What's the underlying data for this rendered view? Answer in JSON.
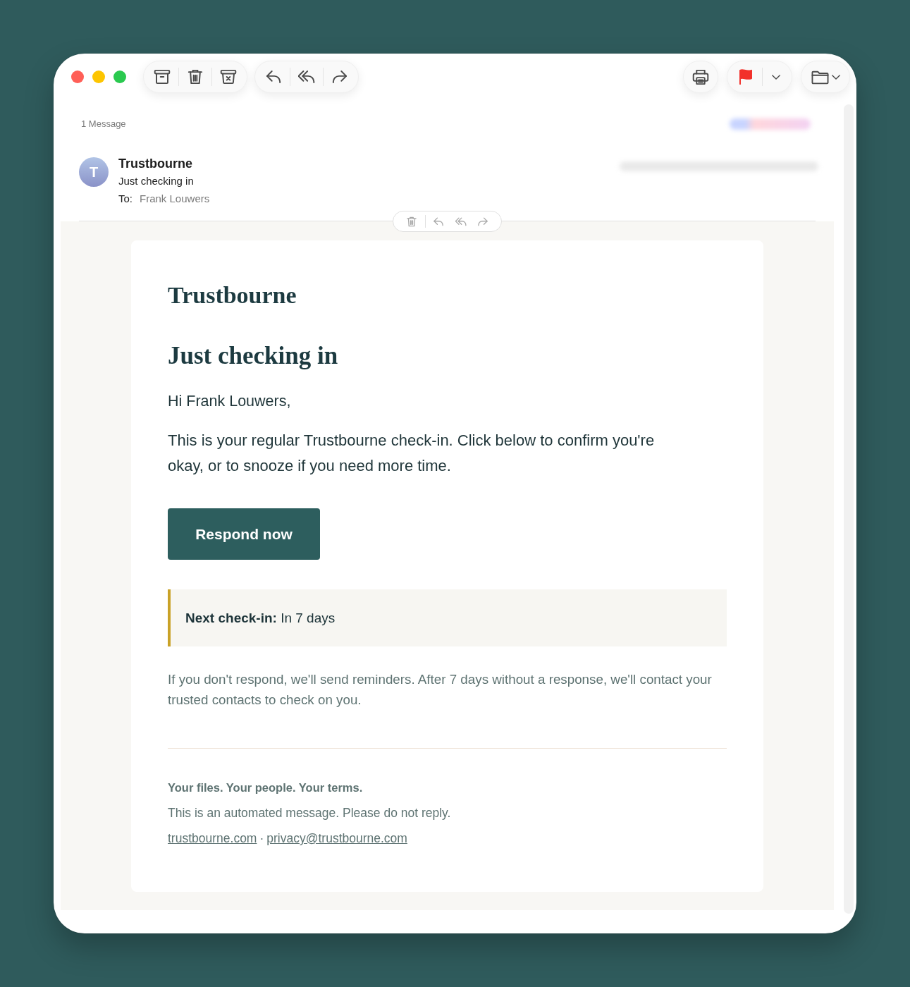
{
  "window": {
    "traffic_lights": [
      {
        "color": "#ff5f57"
      },
      {
        "color": "#fdc500"
      },
      {
        "color": "#2ac94f"
      }
    ]
  },
  "toolbar": {
    "left": [
      {
        "buttons": [
          {
            "kind": "archive"
          },
          {
            "kind": "trash"
          },
          {
            "kind": "junk"
          }
        ]
      },
      {
        "buttons": [
          {
            "kind": "reply"
          },
          {
            "kind": "reply_all"
          },
          {
            "kind": "forward"
          }
        ]
      }
    ],
    "right": [
      {
        "buttons": [
          {
            "kind": "print"
          }
        ]
      },
      {
        "buttons": [
          {
            "kind": "flag"
          },
          {
            "kind": "flag_menu"
          }
        ]
      },
      {
        "buttons": [
          {
            "kind": "move"
          }
        ]
      }
    ]
  },
  "message_count": "1 Message",
  "message": {
    "avatar_initial": "T",
    "sender": "Trustbourne",
    "subject": "Just checking in",
    "to_label": "To:",
    "recipient": "Frank Louwers"
  },
  "hover_actions": [
    {
      "kind": "trash"
    },
    {
      "kind": "reply"
    },
    {
      "kind": "reply_all"
    },
    {
      "kind": "forward"
    }
  ],
  "email": {
    "brand": "Trustbourne",
    "heading": "Just checking in",
    "greeting": "Hi Frank Louwers,",
    "body": "This is your regular Trustbourne check-in. Click below to confirm you're okay, or to snooze if you need more time.",
    "button": "Respond now",
    "callout": "**Next check-in:** In 7 days",
    "note": "If you don't respond, we'll send reminders. After 7 days without a response, we'll contact your trusted contacts to check on you.",
    "footer": {
      "tagline": "Your files. Your people. Your terms.",
      "notice": "This is an automated message. Please do not reply.",
      "links": [
        "trustbourne.com",
        "privacy@trustbourne.com"
      ],
      "separator": "·"
    }
  }
}
